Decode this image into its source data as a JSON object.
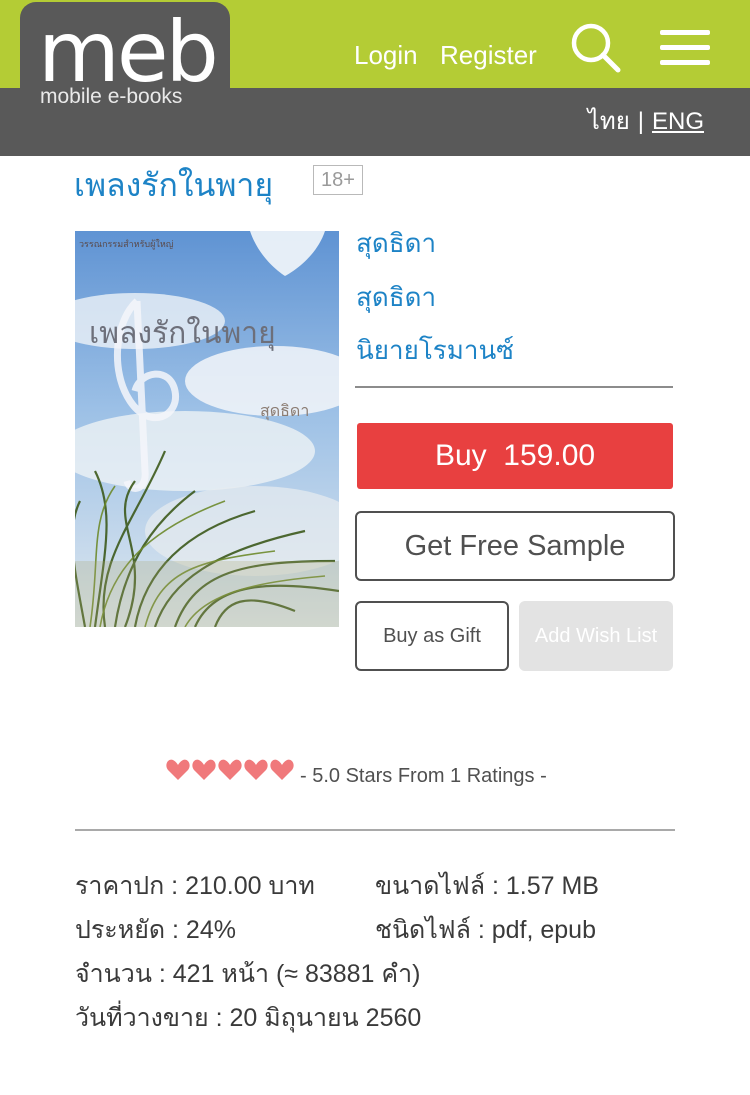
{
  "header": {
    "logo_text": "meb",
    "logo_subtext": "mobile e-books",
    "login_label": "Login",
    "register_label": "Register",
    "search_icon": "search-icon",
    "menu_icon": "hamburger-menu-icon",
    "lang_thai": "ไทย",
    "lang_sep": "|",
    "lang_eng": "ENG"
  },
  "book": {
    "title": "เพลงรักในพายุ",
    "age_rating": "18+",
    "cover_title": "เพลงรักในพายุ",
    "cover_author": "สุดธิดา",
    "cover_series": "วรรณกรรมสำหรับผู้ใหญ่",
    "author": "สุดธิดา",
    "publisher": "สุดธิดา",
    "category": "นิยายโรมานซ์"
  },
  "actions": {
    "buy_label": "Buy  159.00",
    "sample_label": "Get Free Sample",
    "gift_label": "Buy as Gift",
    "wishlist_label": "Add Wish List"
  },
  "rating": {
    "stars": 5,
    "text": "- 5.0 Stars From 1 Ratings -",
    "heart_color": "#f0797b"
  },
  "info": {
    "cover_price": "ราคาปก : 210.00 บาท",
    "file_size": "ขนาดไฟล์ : 1.57 MB",
    "discount": "ประหยัด : 24%",
    "file_type": "ชนิดไฟล์ : pdf, epub",
    "pages": "จำนวน : 421 หน้า (≈ 83881 คำ)",
    "release_date": "วันที่วางขาย : 20 มิถุนายน 2560"
  },
  "colors": {
    "header_green": "#b4cc35",
    "header_gray": "#595959",
    "link_blue": "#1d83c6",
    "buy_red": "#e84040"
  }
}
